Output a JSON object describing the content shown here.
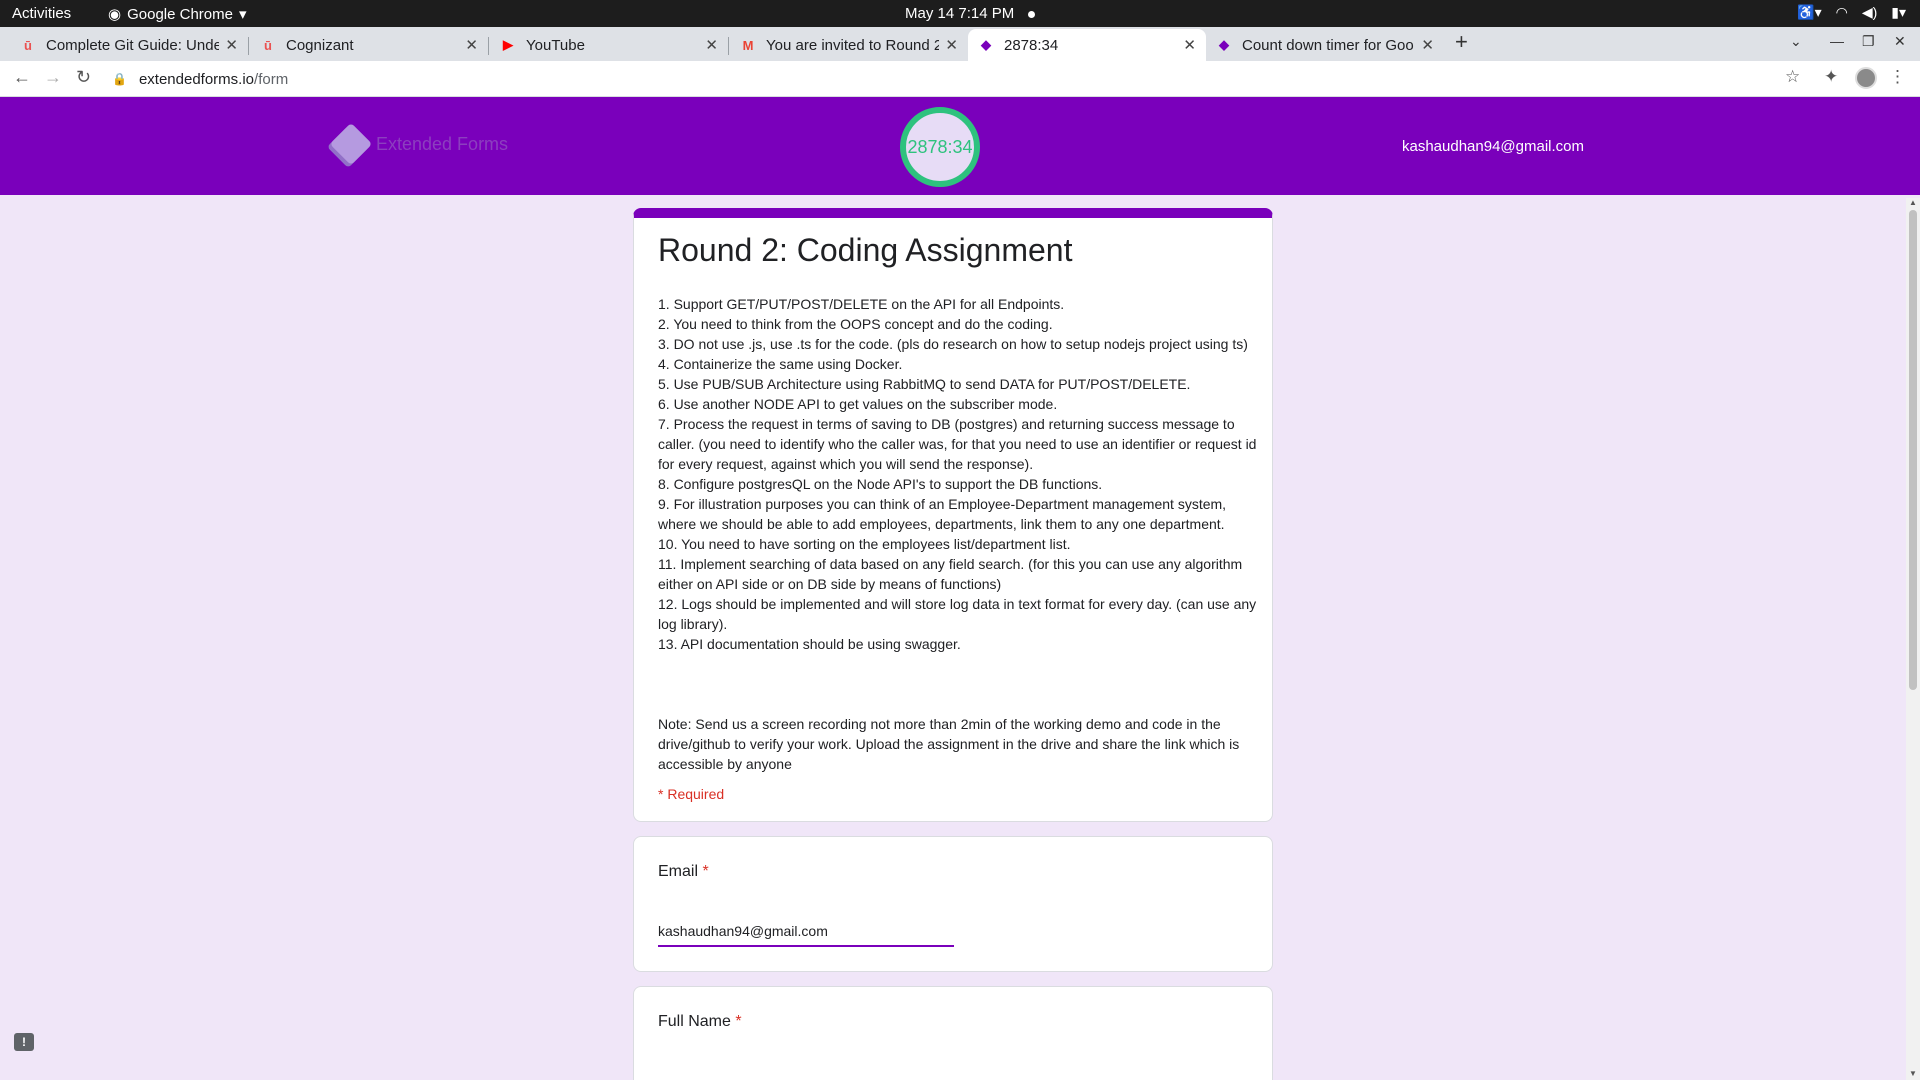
{
  "os": {
    "activities": "Activities",
    "app_name": "Google Chrome",
    "clock": "May 14  7:14 PM"
  },
  "browser": {
    "tabs": [
      {
        "title": "Complete Git Guide: Unde",
        "favicon": "udemy-icon",
        "color": "#ea5252"
      },
      {
        "title": "Cognizant",
        "favicon": "udemy-icon",
        "color": "#ea5252"
      },
      {
        "title": "YouTube",
        "favicon": "youtube-icon",
        "color": "#ff0000"
      },
      {
        "title": "You are invited to Round 2",
        "favicon": "gmail-icon",
        "color": "#ea4335"
      },
      {
        "title": "2878:34",
        "favicon": "extendedforms-icon",
        "color": "#7a00bb"
      },
      {
        "title": "Count down timer for Goo",
        "favicon": "extendedforms-icon",
        "color": "#7a00bb"
      }
    ],
    "url_domain": "extendedforms.io",
    "url_path": "/form"
  },
  "header": {
    "logo_text": "Extended Forms",
    "timer": "2878:34",
    "user_email": "kashaudhan94@gmail.com"
  },
  "form": {
    "title": "Round 2: Coding Assignment",
    "description": [
      "1. Support GET/PUT/POST/DELETE on the API for all Endpoints.",
      "2. You need to think from the OOPS concept and do the coding.",
      "3. DO not use .js, use .ts for the code. (pls do research on how to setup nodejs project using ts)",
      "4. Containerize the same using Docker.",
      "5. Use PUB/SUB Architecture using RabbitMQ to send DATA for PUT/POST/DELETE.",
      "6. Use another NODE API to get values on the subscriber mode.",
      "7. Process the request in terms of saving to DB (postgres) and returning success message to caller. (you need to identify who the caller was, for that you need to use an identifier or request id for every request, against which you will send the response).",
      "8. Configure postgresQL on the Node API's to support the DB functions.",
      "9. For illustration purposes you can think of an Employee-Department management system, where we should be able to add employees, departments, link them to any one department.",
      "10. You need to have sorting on the employees list/department list.",
      "11. Implement searching of data based on any field search. (for this you can use any algorithm either on API side or on DB side by means of functions)",
      "12. Logs should be implemented and will store log data in text format for every day. (can use any log library).",
      "13. API documentation should be using swagger."
    ],
    "note": "Note:  Send us a screen recording not more than 2min of the working demo and code in the drive/github to verify your work. Upload the assignment in the drive and share the link which is accessible by anyone",
    "required_label": "* Required",
    "email_label": "Email",
    "email_value": "kashaudhan94@gmail.com",
    "fullname_label": "Full Name",
    "required_star": "*"
  },
  "colors": {
    "brand": "#7a00bb",
    "timer": "#2ec27e",
    "background": "#f0e6f8",
    "required": "#d93025"
  }
}
